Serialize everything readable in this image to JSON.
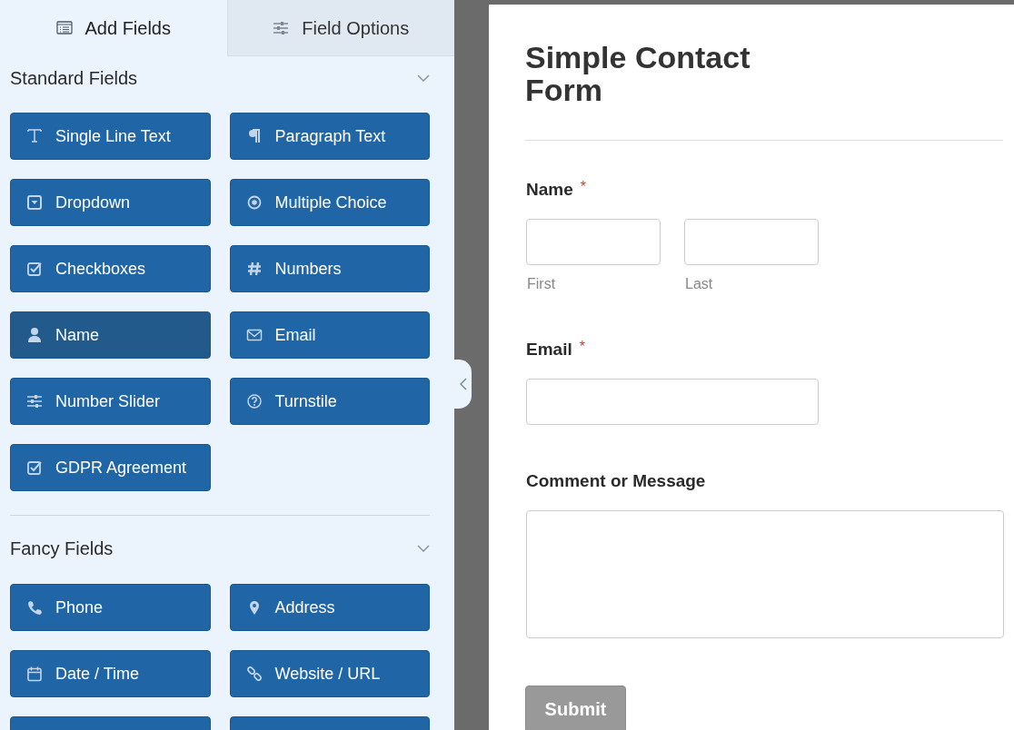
{
  "tabs": [
    {
      "label": "Add Fields",
      "kind": "list",
      "selected": true
    },
    {
      "label": "Field Options",
      "kind": "sliders",
      "selected": false
    }
  ],
  "sections": [
    {
      "title": "Standard Fields",
      "expanded": true,
      "fields": [
        {
          "label": "Single Line Text",
          "kind": "text",
          "selected": false
        },
        {
          "label": "Paragraph Text",
          "kind": "paragraph",
          "selected": false
        },
        {
          "label": "Dropdown",
          "kind": "dropdown",
          "selected": false
        },
        {
          "label": "Multiple Choice",
          "kind": "radio",
          "selected": false
        },
        {
          "label": "Checkboxes",
          "kind": "checkbox",
          "selected": false
        },
        {
          "label": "Numbers",
          "kind": "number",
          "selected": false
        },
        {
          "label": "Name",
          "kind": "person",
          "selected": true
        },
        {
          "label": "Email",
          "kind": "envelope",
          "selected": false
        },
        {
          "label": "Number Slider",
          "kind": "sliders",
          "selected": false
        },
        {
          "label": "Turnstile",
          "kind": "question",
          "selected": false
        },
        {
          "label": "GDPR Agreement",
          "kind": "checkbox",
          "selected": false
        }
      ]
    },
    {
      "title": "Fancy Fields",
      "expanded": true,
      "fields": [
        {
          "label": "Phone",
          "kind": "phone",
          "selected": false
        },
        {
          "label": "Address",
          "kind": "pin",
          "selected": false
        },
        {
          "label": "Date / Time",
          "kind": "calendar",
          "selected": false
        },
        {
          "label": "Website / URL",
          "kind": "link",
          "selected": false
        }
      ]
    }
  ],
  "form": {
    "title": "Simple Contact\nForm",
    "fields": [
      {
        "kind": "name",
        "label": "Name",
        "required_mark": "*",
        "sublabels": [
          "First",
          "Last"
        ]
      },
      {
        "kind": "email",
        "label": "Email",
        "required_mark": "*"
      },
      {
        "kind": "textarea",
        "label": "Comment or Message"
      }
    ],
    "submit": {
      "label": "Submit",
      "disabled": true
    }
  }
}
